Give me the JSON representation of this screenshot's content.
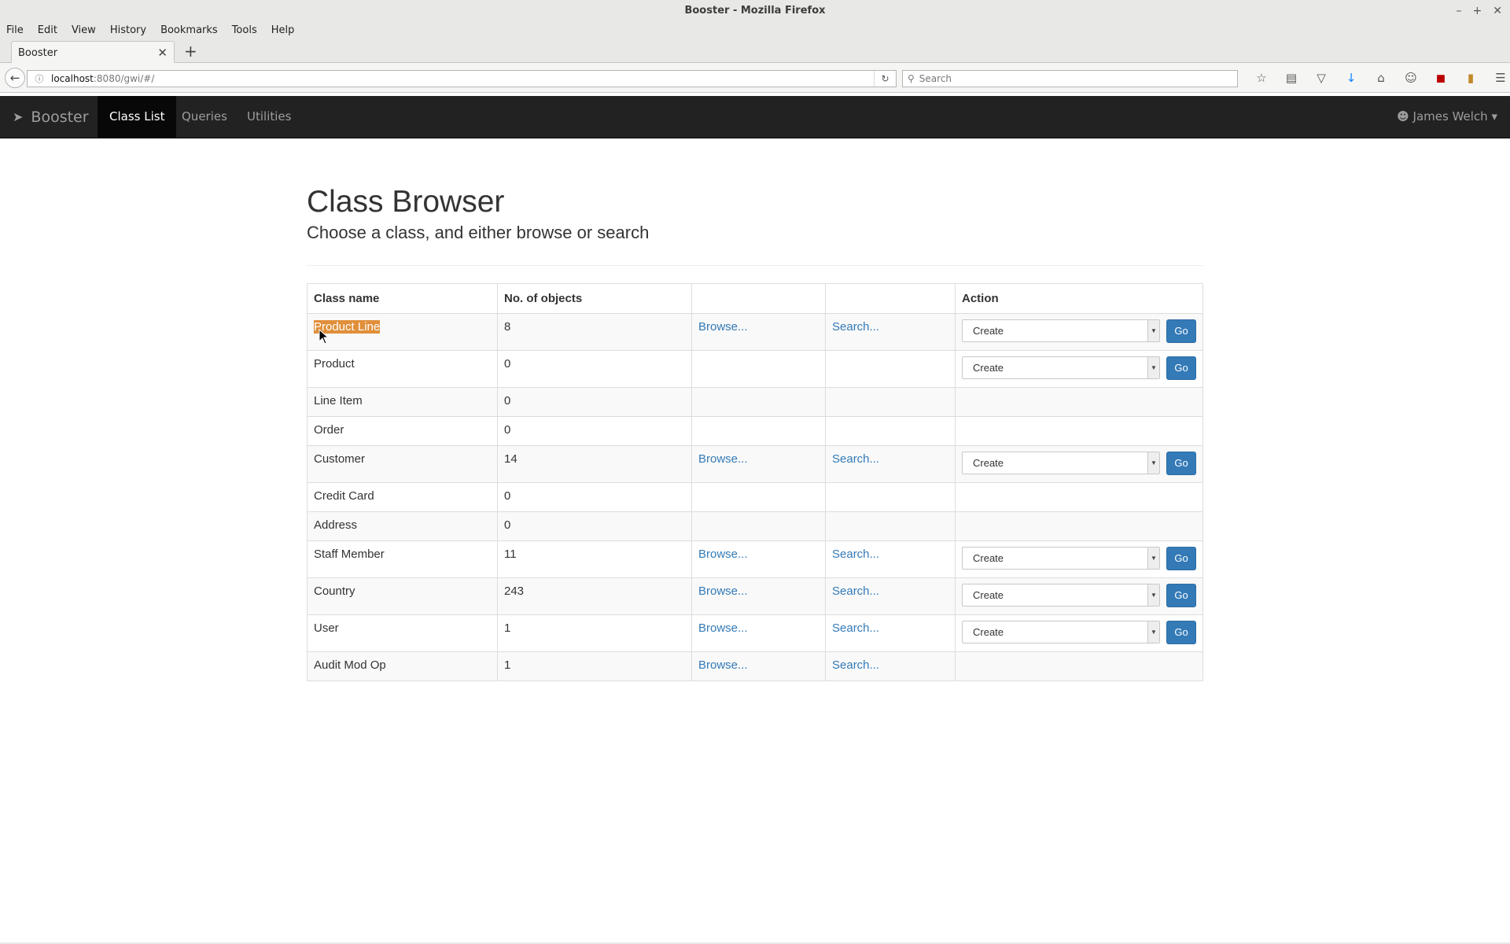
{
  "window": {
    "title": "Booster - Mozilla Firefox",
    "controls": [
      "–",
      "+",
      "✕"
    ]
  },
  "menubar": [
    "File",
    "Edit",
    "View",
    "History",
    "Bookmarks",
    "Tools",
    "Help"
  ],
  "tab": {
    "title": "Booster",
    "close": "✕",
    "new_tab": "+"
  },
  "navbar": {
    "url_host": "localhost",
    "url_rest": ":8080/gwi/#/",
    "search_placeholder": "Search"
  },
  "app": {
    "brand": "Booster",
    "nav": [
      "Class List",
      "Queries",
      "Utilities"
    ],
    "active_nav": "Class List",
    "user": "James Welch"
  },
  "page": {
    "title": "Class Browser",
    "subtitle": "Choose a class, and either browse or search"
  },
  "table": {
    "headers": [
      "Class name",
      "No. of objects",
      "",
      "",
      "Action"
    ],
    "rows": [
      {
        "name": "Product Line",
        "count": "8",
        "browse": "Browse...",
        "search": "Search...",
        "action": "Create",
        "go": "Go",
        "highlighted": true
      },
      {
        "name": "Product",
        "count": "0",
        "browse": "",
        "search": "",
        "action": "Create",
        "go": "Go"
      },
      {
        "name": "Line Item",
        "count": "0",
        "browse": "",
        "search": "",
        "action": "",
        "go": ""
      },
      {
        "name": "Order",
        "count": "0",
        "browse": "",
        "search": "",
        "action": "",
        "go": ""
      },
      {
        "name": "Customer",
        "count": "14",
        "browse": "Browse...",
        "search": "Search...",
        "action": "Create",
        "go": "Go"
      },
      {
        "name": "Credit Card",
        "count": "0",
        "browse": "",
        "search": "",
        "action": "",
        "go": ""
      },
      {
        "name": "Address",
        "count": "0",
        "browse": "",
        "search": "",
        "action": "",
        "go": ""
      },
      {
        "name": "Staff Member",
        "count": "11",
        "browse": "Browse...",
        "search": "Search...",
        "action": "Create",
        "go": "Go"
      },
      {
        "name": "Country",
        "count": "243",
        "browse": "Browse...",
        "search": "Search...",
        "action": "Create",
        "go": "Go"
      },
      {
        "name": "User",
        "count": "1",
        "browse": "Browse...",
        "search": "Search...",
        "action": "Create",
        "go": "Go"
      },
      {
        "name": "Audit Mod Op",
        "count": "1",
        "browse": "Browse...",
        "search": "Search...",
        "action": "",
        "go": ""
      }
    ]
  },
  "colors": {
    "link": "#337ab7",
    "go_button": "#337ab7",
    "navbar_bg": "#222222",
    "highlight": "#e08f3a"
  }
}
